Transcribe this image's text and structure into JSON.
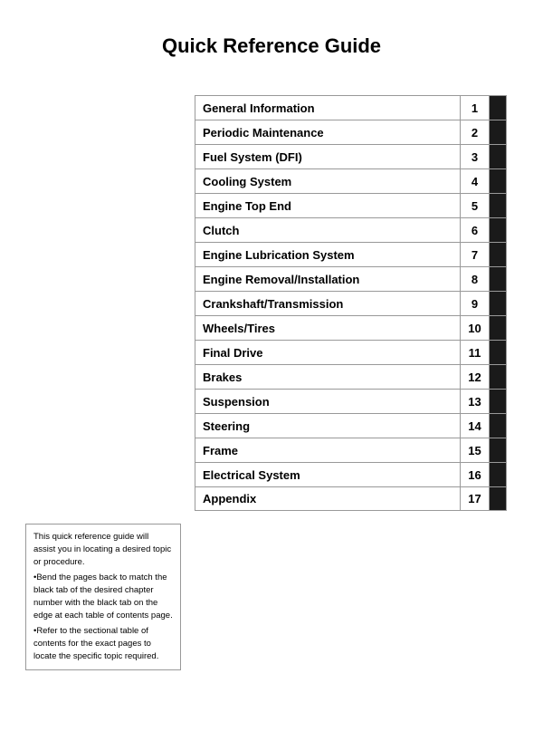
{
  "page": {
    "title": "Quick Reference Guide"
  },
  "toc": {
    "rows": [
      {
        "label": "General Information",
        "number": "1"
      },
      {
        "label": "Periodic Maintenance",
        "number": "2"
      },
      {
        "label": "Fuel System (DFI)",
        "number": "3"
      },
      {
        "label": "Cooling System",
        "number": "4"
      },
      {
        "label": "Engine Top End",
        "number": "5"
      },
      {
        "label": "Clutch",
        "number": "6"
      },
      {
        "label": "Engine Lubrication System",
        "number": "7"
      },
      {
        "label": "Engine Removal/Installation",
        "number": "8"
      },
      {
        "label": "Crankshaft/Transmission",
        "number": "9"
      },
      {
        "label": "Wheels/Tires",
        "number": "10"
      },
      {
        "label": "Final Drive",
        "number": "11"
      },
      {
        "label": "Brakes",
        "number": "12"
      },
      {
        "label": "Suspension",
        "number": "13"
      },
      {
        "label": "Steering",
        "number": "14"
      },
      {
        "label": "Frame",
        "number": "15"
      },
      {
        "label": "Electrical System",
        "number": "16"
      },
      {
        "label": "Appendix",
        "number": "17"
      }
    ]
  },
  "note": {
    "line1": "This quick reference guide will assist you in locating a desired topic or procedure.",
    "line2": "•Bend the pages back to match the black tab of the desired chapter number with the black tab on the edge at each table of contents page.",
    "line3": "•Refer to the sectional table of contents for the exact pages to locate the specific topic required."
  }
}
